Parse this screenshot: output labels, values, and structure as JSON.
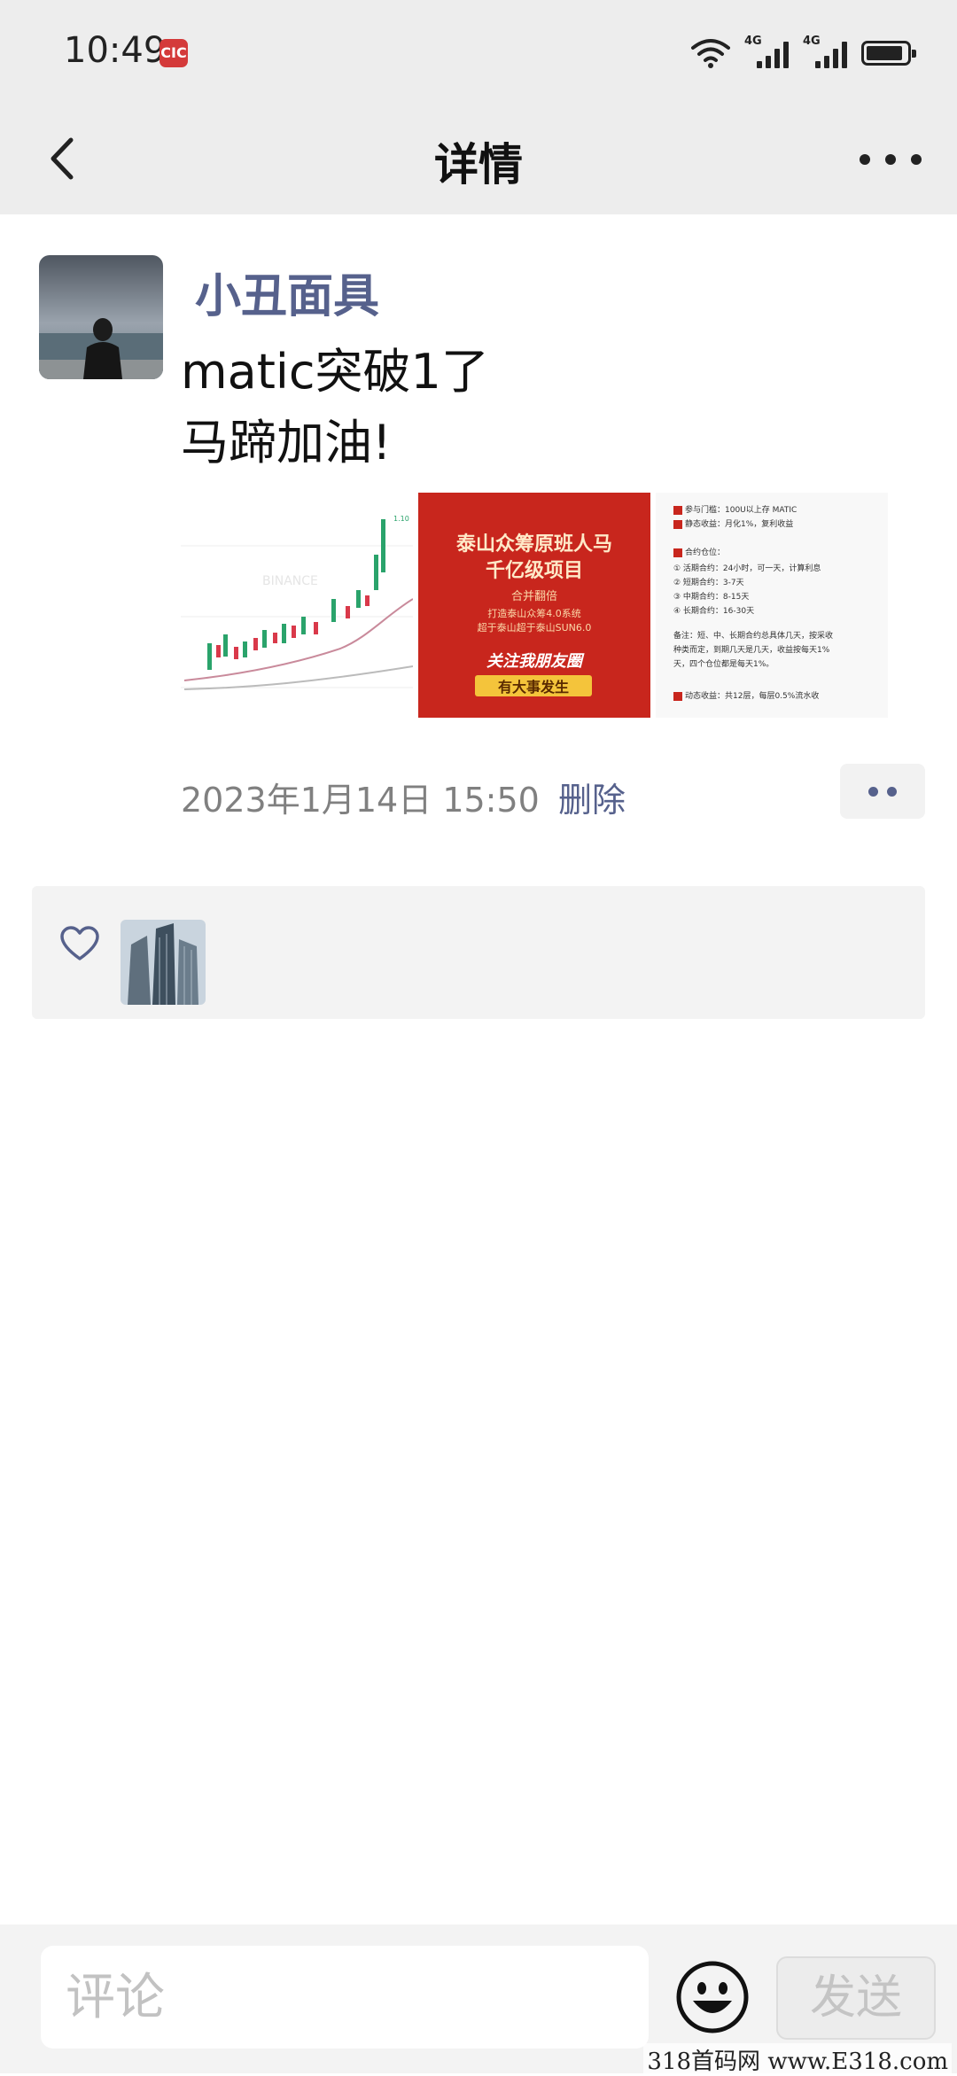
{
  "status_bar": {
    "time": "10:49",
    "app_badge": "CIC",
    "signal1_label": "4G",
    "signal2_label": "4G"
  },
  "nav": {
    "title": "详情"
  },
  "post": {
    "username": "小丑面具",
    "text_line1": "matic突破1了",
    "text_line2": "马蹄加油!",
    "image2": {
      "line1": "泰山众筹原班人马",
      "line2": "千亿级项目",
      "line3": "合并翻倍",
      "line4": "打造泰山众筹4.0系统",
      "line5": "超于泰山超于泰山SUN6.0",
      "line6": "关注我朋友圈",
      "line7": "有大事发生"
    },
    "image3_rows": [
      "参与门槛：100U以上存 MATIC",
      "静态收益：月化1%，复利收益",
      "合约仓位：",
      "① 活期合约：24小时，可一天，计算利息",
      "② 短期合约：3-7天",
      "③ 中期合约：8-15天",
      "④ 长期合约：16-30天",
      "备注：短、中、长期合约总具体几天，按采收",
      "种类而定，到期几天是几天，收益按每天1%",
      "天，四个仓位都是每天1%。",
      "动态收益：共12层，每层0.5%流水收"
    ],
    "timestamp": "2023年1月14日 15:50",
    "delete_label": "删除"
  },
  "comment_bar": {
    "placeholder": "评论",
    "send_label": "发送"
  },
  "watermark": "318首码网 www.E318.com",
  "colors": {
    "link": "#56618c",
    "bar_bg": "#ededed",
    "red_card": "#c8261d"
  }
}
